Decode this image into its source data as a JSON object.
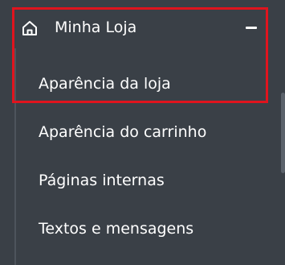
{
  "menu": {
    "section": {
      "label": "Minha Loja",
      "icon": "home-icon",
      "toggle_icon": "minus-icon",
      "state": "expanded"
    },
    "items": [
      {
        "label": "Aparência da loja"
      },
      {
        "label": "Aparência do carrinho"
      },
      {
        "label": "Páginas internas"
      },
      {
        "label": "Textos e mensagens"
      }
    ]
  },
  "colors": {
    "background": "#3a4047",
    "text": "#ffffff",
    "highlight": "#e0141e"
  }
}
